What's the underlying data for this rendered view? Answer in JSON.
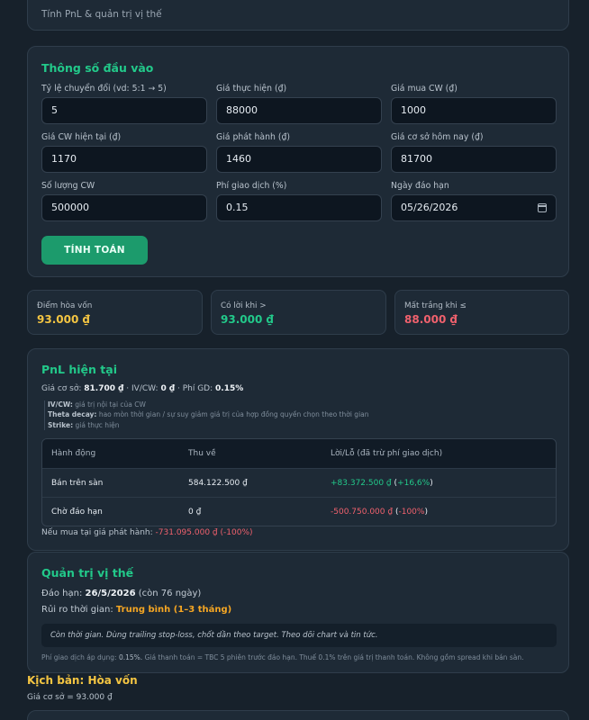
{
  "header": {
    "subtitle": "Tính PnL & quản trị vị thế"
  },
  "inputs": {
    "title": "Thông số đầu vào",
    "fields": [
      {
        "label": "Tỷ lệ chuyển đổi (vd: 5:1 → 5)",
        "value": "5"
      },
      {
        "label": "Giá thực hiện (₫)",
        "value": "88000"
      },
      {
        "label": "Giá mua CW (₫)",
        "value": "1000"
      },
      {
        "label": "Giá CW hiện tại (₫)",
        "value": "1170"
      },
      {
        "label": "Giá phát hành (₫)",
        "value": "1460"
      },
      {
        "label": "Giá cơ sở hôm nay (₫)",
        "value": "81700"
      },
      {
        "label": "Số lượng CW",
        "value": "500000"
      },
      {
        "label": "Phí giao dịch (%)",
        "value": "0.15"
      },
      {
        "label": "Ngày đáo hạn",
        "value": "05/26/2026"
      }
    ],
    "calc_button": "TÍNH TOÁN"
  },
  "stats": [
    {
      "label": "Điểm hòa vốn",
      "value": "93.000 ₫",
      "color": "#f4c542"
    },
    {
      "label": "Có lời khi >",
      "value": "93.000 ₫",
      "color": "#22c98a"
    },
    {
      "label": "Mất trắng khi ≤",
      "value": "88.000 ₫",
      "color": "#f0616d"
    }
  ],
  "pnl": {
    "title": "PnL hiện tại",
    "base_label": "Giá cơ sở:",
    "base_value": "81.700 ₫",
    "ivcw_label": "· IV/CW:",
    "ivcw_value": "0 ₫",
    "fee_label": "· Phí GD:",
    "fee_value": "0.15%",
    "legend": [
      {
        "term": "IV/CW:",
        "desc": "giá trị nội tại của CW"
      },
      {
        "term": "Theta decay:",
        "desc": "hao mòn thời gian / sự suy giảm giá trị của hợp đồng quyền chọn theo thời gian"
      },
      {
        "term": "Strike:",
        "desc": "giá thực hiện"
      }
    ],
    "table": {
      "headers": [
        "Hành động",
        "Thu về",
        "Lời/Lỗ (đã trừ phí giao dịch)"
      ],
      "rows": [
        {
          "action": "Bán trên sàn",
          "proceeds": "584.122.500 ₫",
          "pnl": "+83.372.500 ₫",
          "pct_open": "(",
          "pct": "+16,6%",
          "pct_close": ")",
          "pos": true
        },
        {
          "action": "Chờ đáo hạn",
          "proceeds": "0 ₫",
          "pnl": "-500.750.000 ₫",
          "pct_open": "(",
          "pct": "-100%",
          "pct_close": ")",
          "pos": false
        }
      ]
    },
    "note_label": "Nếu mua tại giá phát hành:",
    "note_value": "-731.095.000 ₫",
    "note_pct": "(-100%)"
  },
  "position": {
    "title": "Quản trị vị thế",
    "expiry_label": "Đáo hạn:",
    "expiry_value": "26/5/2026",
    "expiry_remaining": "(còn 76 ngày)",
    "risk_label": "Rủi ro thời gian:",
    "risk_value": "Trung bình (1–3 tháng)",
    "advice": "Còn thời gian. Dùng trailing stop-loss, chốt dần theo target. Theo dõi chart và tin tức.",
    "foot_prefix": "Phí giao dịch áp dụng:",
    "foot_fee": "0.15%.",
    "foot_rest": "Giá thanh toán = TBC 5 phiên trước đáo hạn. Thuế 0.1% trên giá trị thanh toán. Không gồm spread khi bán sàn."
  },
  "scenario": {
    "title": "Kịch bản: Hòa vốn",
    "base": "Giá cơ sở = 93.000 ₫"
  }
}
